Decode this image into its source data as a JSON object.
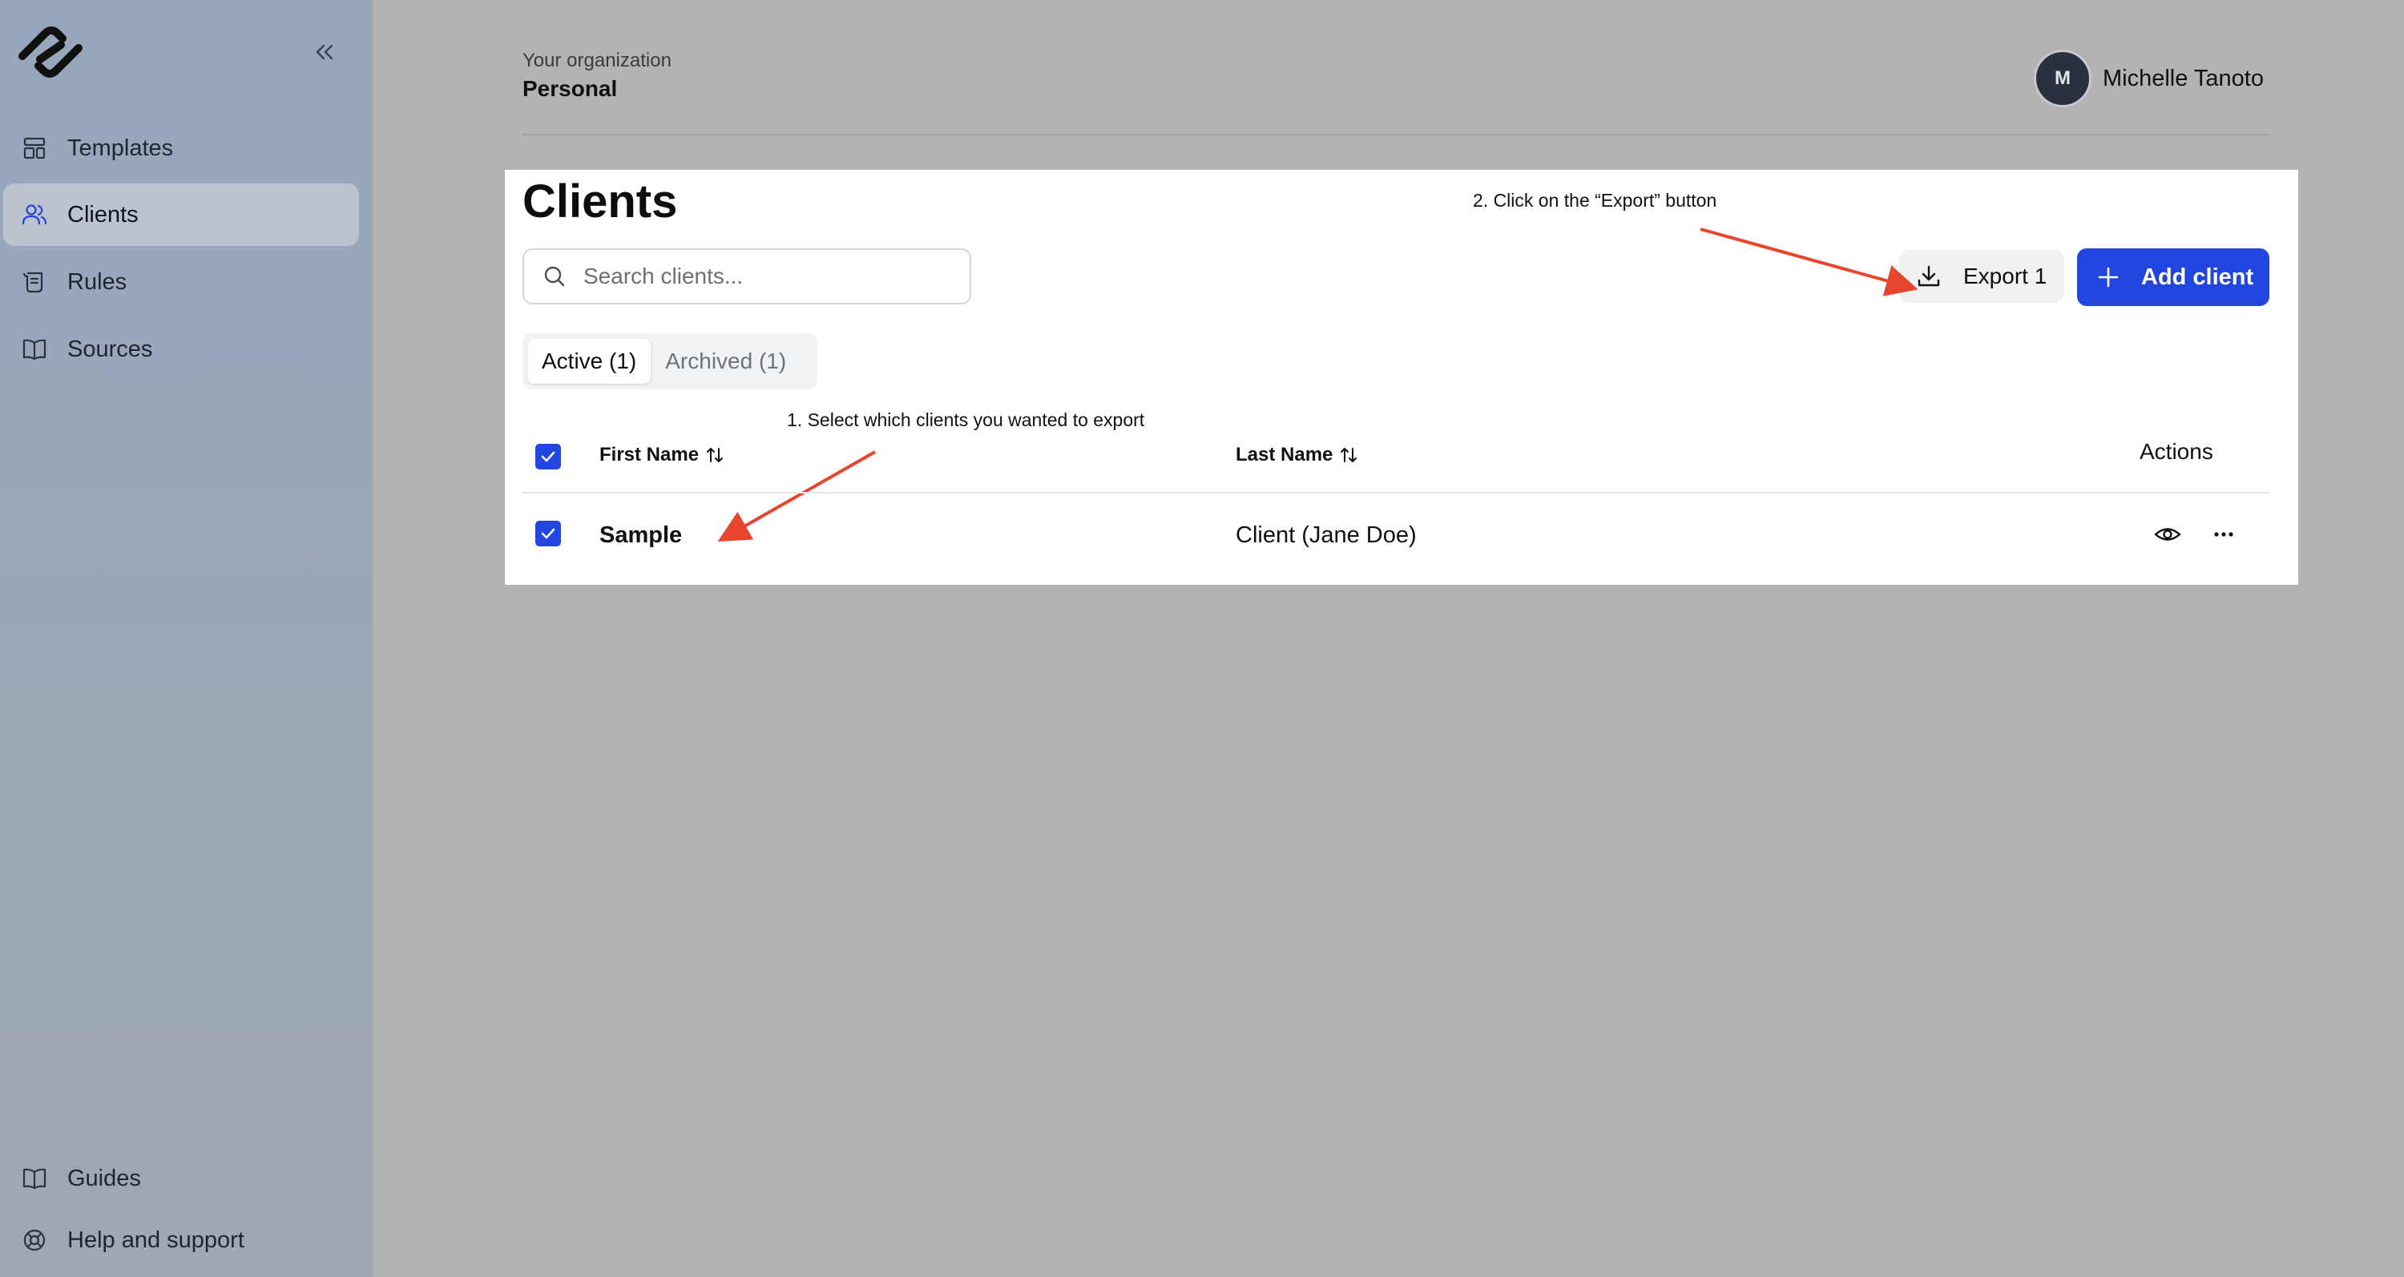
{
  "sidebar": {
    "items": [
      {
        "label": "Templates",
        "icon": "layout-template-icon"
      },
      {
        "label": "Clients",
        "icon": "users-icon",
        "active": true
      },
      {
        "label": "Rules",
        "icon": "scroll-icon"
      },
      {
        "label": "Sources",
        "icon": "book-open-icon"
      }
    ],
    "footer_items": [
      {
        "label": "Guides",
        "icon": "book-open-icon"
      },
      {
        "label": "Help and support",
        "icon": "life-buoy-icon"
      }
    ]
  },
  "header": {
    "org_caption": "Your organization",
    "org_name": "Personal",
    "user": {
      "initial": "M",
      "name": "Michelle Tanoto"
    }
  },
  "page": {
    "title": "Clients",
    "search_placeholder": "Search clients...",
    "tabs": [
      {
        "label": "Active (1)",
        "active": true
      },
      {
        "label": "Archived (1)",
        "active": false
      }
    ],
    "export_label": "Export 1",
    "add_label": "Add client"
  },
  "table": {
    "columns": {
      "first": "First Name",
      "last": "Last Name",
      "actions": "Actions"
    },
    "rows": [
      {
        "first": "Sample",
        "last": "Client (Jane Doe)",
        "checked": true
      }
    ]
  },
  "annotations": {
    "step1": "1. Select which clients you wanted to export",
    "step2": "2. Click on the “Export” button"
  },
  "colors": {
    "accent": "#2146e0",
    "annotation_arrow": "#e8452e",
    "avatar": "#293040"
  }
}
